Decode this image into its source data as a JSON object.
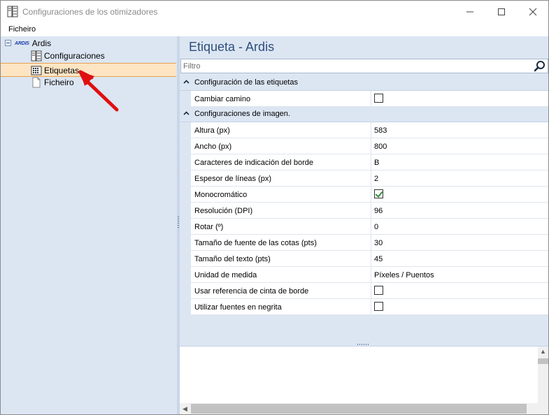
{
  "window": {
    "title": "Configuraciones de los otimizadores"
  },
  "menubar": {
    "items": [
      "Ficheiro"
    ]
  },
  "tree": {
    "root": {
      "logo_text": "ARDIS",
      "label": "Ardis"
    },
    "items": [
      {
        "label": "Configuraciones",
        "icon": "config-icon",
        "selected": false
      },
      {
        "label": "Etiquetas",
        "icon": "label-icon",
        "selected": true
      },
      {
        "label": "Ficheiro",
        "icon": "file-icon",
        "selected": false
      }
    ]
  },
  "panel": {
    "title": "Etiqueta - Ardis",
    "filter_placeholder": "Filtro",
    "categories": [
      {
        "label": "Configuración de las etiquetas",
        "properties": [
          {
            "name": "Cambiar camino",
            "type": "checkbox",
            "checked": false
          }
        ]
      },
      {
        "label": "Configuraciones de imagen.",
        "properties": [
          {
            "name": "Altura (px)",
            "type": "text",
            "value": "583"
          },
          {
            "name": "Ancho (px)",
            "type": "text",
            "value": "800"
          },
          {
            "name": "Caracteres de indicación del borde",
            "type": "text",
            "value": "B"
          },
          {
            "name": "Espesor de líneas (px)",
            "type": "text",
            "value": "2"
          },
          {
            "name": "Monocromático",
            "type": "checkbox",
            "checked": true
          },
          {
            "name": "Resolución (DPI)",
            "type": "text",
            "value": "96"
          },
          {
            "name": "Rotar (º)",
            "type": "text",
            "value": "0"
          },
          {
            "name": "Tamaño de fuente de las cotas (pts)",
            "type": "text",
            "value": "30"
          },
          {
            "name": "Tamaño del texto (pts)",
            "type": "text",
            "value": "45"
          },
          {
            "name": "Unidad de medida",
            "type": "text",
            "value": "Píxeles / Puentos"
          },
          {
            "name": "Usar referencia de cinta de borde",
            "type": "checkbox",
            "checked": false
          },
          {
            "name": "Utilizar fuentes en negrita",
            "type": "checkbox",
            "checked": false
          }
        ]
      }
    ]
  },
  "colors": {
    "panel_bg": "#dce6f3",
    "selection_bg": "#fde5c4",
    "title_color": "#2f4f7a",
    "annotation_arrow": "#e01010"
  }
}
